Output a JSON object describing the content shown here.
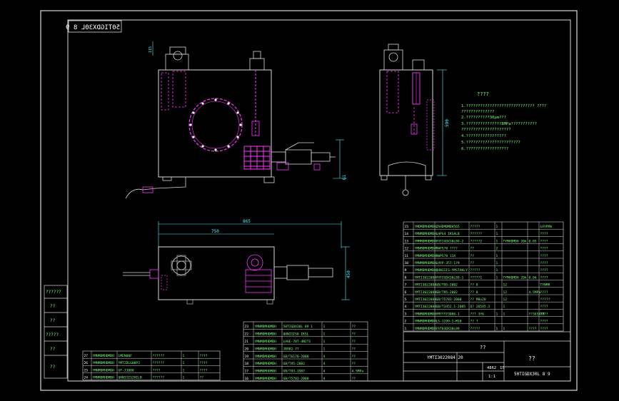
{
  "drawing": {
    "code_stamp": "50TIGDX30L 8 9",
    "title_block": {
      "drawing_no": "50TIGDX30L 8 9",
      "code_line": "YMTI3022084 20",
      "unknown_title": "??",
      "scale": "1:1",
      "sheet_left": "4862",
      "sheet_right": "15",
      "name_label": "??"
    },
    "notes": {
      "heading": "????",
      "lines": [
        "1.????????????????????????????? ????",
        "  ??????????????",
        "2.??????????30µm???",
        "3.???????????????8MPa???????????",
        "  ?????????????????????",
        "4.?????????????????",
        "5.???????????????????????",
        "6.??????????????????"
      ]
    },
    "left_stamp_labels": [
      "??????",
      "??",
      "??",
      "?????",
      "??",
      "??"
    ],
    "bom_right": [
      {
        "no": "15",
        "code": "YMDMDMHDMDH",
        "name": "ZAHDMDMDH565",
        "qty": "1",
        "note": "?????",
        "mat": "",
        "w": "",
        "total": "LHYPMA"
      },
      {
        "no": "14",
        "code": "YMNMDMHDMDH",
        "name": "LHPG4 IKSALB",
        "qty": "1",
        "note": "??????",
        "mat": "",
        "w": "",
        "total": "????"
      },
      {
        "no": "13",
        "code": "YMMMDMHDMDH",
        "name": "YHTIGDX30L89-2",
        "qty": "1",
        "note": "?????2",
        "mat": "TYMHDMDH 20k",
        "w": "0.05",
        "total": "????"
      },
      {
        "no": "12",
        "code": "YMNMDMHDMDH",
        "name": "RWPS70 ????",
        "qty": "2",
        "note": "??",
        "mat": "",
        "w": "",
        "total": "????"
      },
      {
        "no": "11",
        "code": "YMNMDMHDMDH",
        "name": "RWPS70 11X",
        "qty": "1",
        "note": "??",
        "mat": "",
        "w": "",
        "total": "????"
      },
      {
        "no": "10",
        "code": "YMNMDMHDMDH",
        "name": "LHYP-35T-1?9",
        "qty": "1",
        "note": "??",
        "mat": "",
        "w": "",
        "total": "????"
      },
      {
        "no": "9",
        "code": "YMNMDMHDMDH",
        "name": "QHNIIIS-YMSTAKLY",
        "qty": "1",
        "note": "?????",
        "mat": "",
        "w": "",
        "total": "????"
      },
      {
        "no": "8",
        "code": "YMTI3022084",
        "name": "YHTIGDX30L89-1",
        "qty": "1",
        "note": "?????1",
        "mat": "TYMHDMDH 20k",
        "w": "0.04",
        "total": "????"
      },
      {
        "no": "7",
        "code": "YMTI3022084",
        "name": "GB/T95-2002",
        "qty": "",
        "note": "?? 8",
        "mat": "12",
        "w": "",
        "total": "TYNMR"
      },
      {
        "no": "6",
        "code": "YMTI3022084",
        "name": "GB/T95-2002",
        "qty": "",
        "note": "?? 8",
        "mat": "12",
        "w": "4.5MPa",
        "total": "????"
      },
      {
        "no": "5",
        "code": "YMTI3022084",
        "name": "GB/T5783-2000",
        "qty": "",
        "note": "?? M8x20",
        "mat": "12",
        "w": "",
        "total": "?????"
      },
      {
        "no": "4",
        "code": "YMTI3022084",
        "name": "GB/T3452.1-2005",
        "qty": "",
        "note": "O? 265X5.3",
        "mat": "1",
        "w": "",
        "total": "????"
      },
      {
        "no": "3",
        "code": "YMNMDMHDMDH",
        "name": "YMYYYY3086-1",
        "qty": "1",
        "note": "??? 3f6",
        "mat": "1",
        "w": "Y?365XY8",
        "total": "????"
      },
      {
        "no": "2",
        "code": "YMNMDMHDMDH",
        "name": "LS-1299-1-M10",
        "qty": "",
        "note": "?? ?",
        "mat": "",
        "w": "",
        "total": "????"
      },
      {
        "no": "1",
        "code": "YMNMDMHDMDH",
        "name": "YAT03DX30L89",
        "qty": "1",
        "note": "?????",
        "mat": "1",
        "w": "????",
        "total": "????"
      }
    ],
    "bom_mid": [
      {
        "no": "23",
        "code": "YMNMDMHDMDH",
        "name": "50TIGDX30L 89 1",
        "qty": "1",
        "note": "??"
      },
      {
        "no": "22",
        "code": "YMNMDMHDMDH",
        "name": "QHNIIIS0 IKSL",
        "qty": "1",
        "note": "??"
      },
      {
        "no": "21",
        "code": "YMNMDMHDMDH",
        "name": "LHVE-70T-4N2T1",
        "qty": "1",
        "note": "??"
      },
      {
        "no": "20",
        "code": "YMNMDMHDMDH",
        "name": "JB982-77",
        "qty": "1",
        "note": "??"
      },
      {
        "no": "19",
        "code": "YMNMDMHDMDH",
        "name": "GB/T6170-2000",
        "qty": "4",
        "note": "??"
      },
      {
        "no": "18",
        "code": "YMNMDMHDMDH",
        "name": "GB/T95-2002",
        "qty": "4",
        "note": "??"
      },
      {
        "no": "17",
        "code": "YMNMDMHDMDH",
        "name": "GB/T93-1987",
        "qty": "4",
        "note": "4.5MPa"
      },
      {
        "no": "16",
        "code": "YMNMDMHDMDH",
        "name": "GB/T5783-2000",
        "qty": "4",
        "note": "??"
      }
    ],
    "bom_left": [
      {
        "no": "27",
        "code": "YMNMDMHDMDH",
        "name": "LMEN00F",
        "note": "??????",
        "qty": "1",
        "m": "????"
      },
      {
        "no": "26",
        "code": "YMNMDMHDMDH",
        "name": "YMTIDLG00P3",
        "note": "??????",
        "qty": "1",
        "m": "????"
      },
      {
        "no": "25",
        "code": "YMNMDMHDMDH",
        "name": "GF-J3000",
        "note": "????",
        "qty": "1",
        "m": "????"
      },
      {
        "no": "24",
        "code": "YMNMDMHDMDH",
        "name": "QHNIIIS2HILB",
        "note": "??????",
        "qty": "1",
        "m": "??"
      }
    ],
    "dims": {
      "top_width": "865",
      "top_inner": "750",
      "side_height": "600",
      "right_height": "590",
      "plan_depth": "450",
      "left_small": "115",
      "outlet": "G1",
      "dim_c": "240"
    }
  }
}
